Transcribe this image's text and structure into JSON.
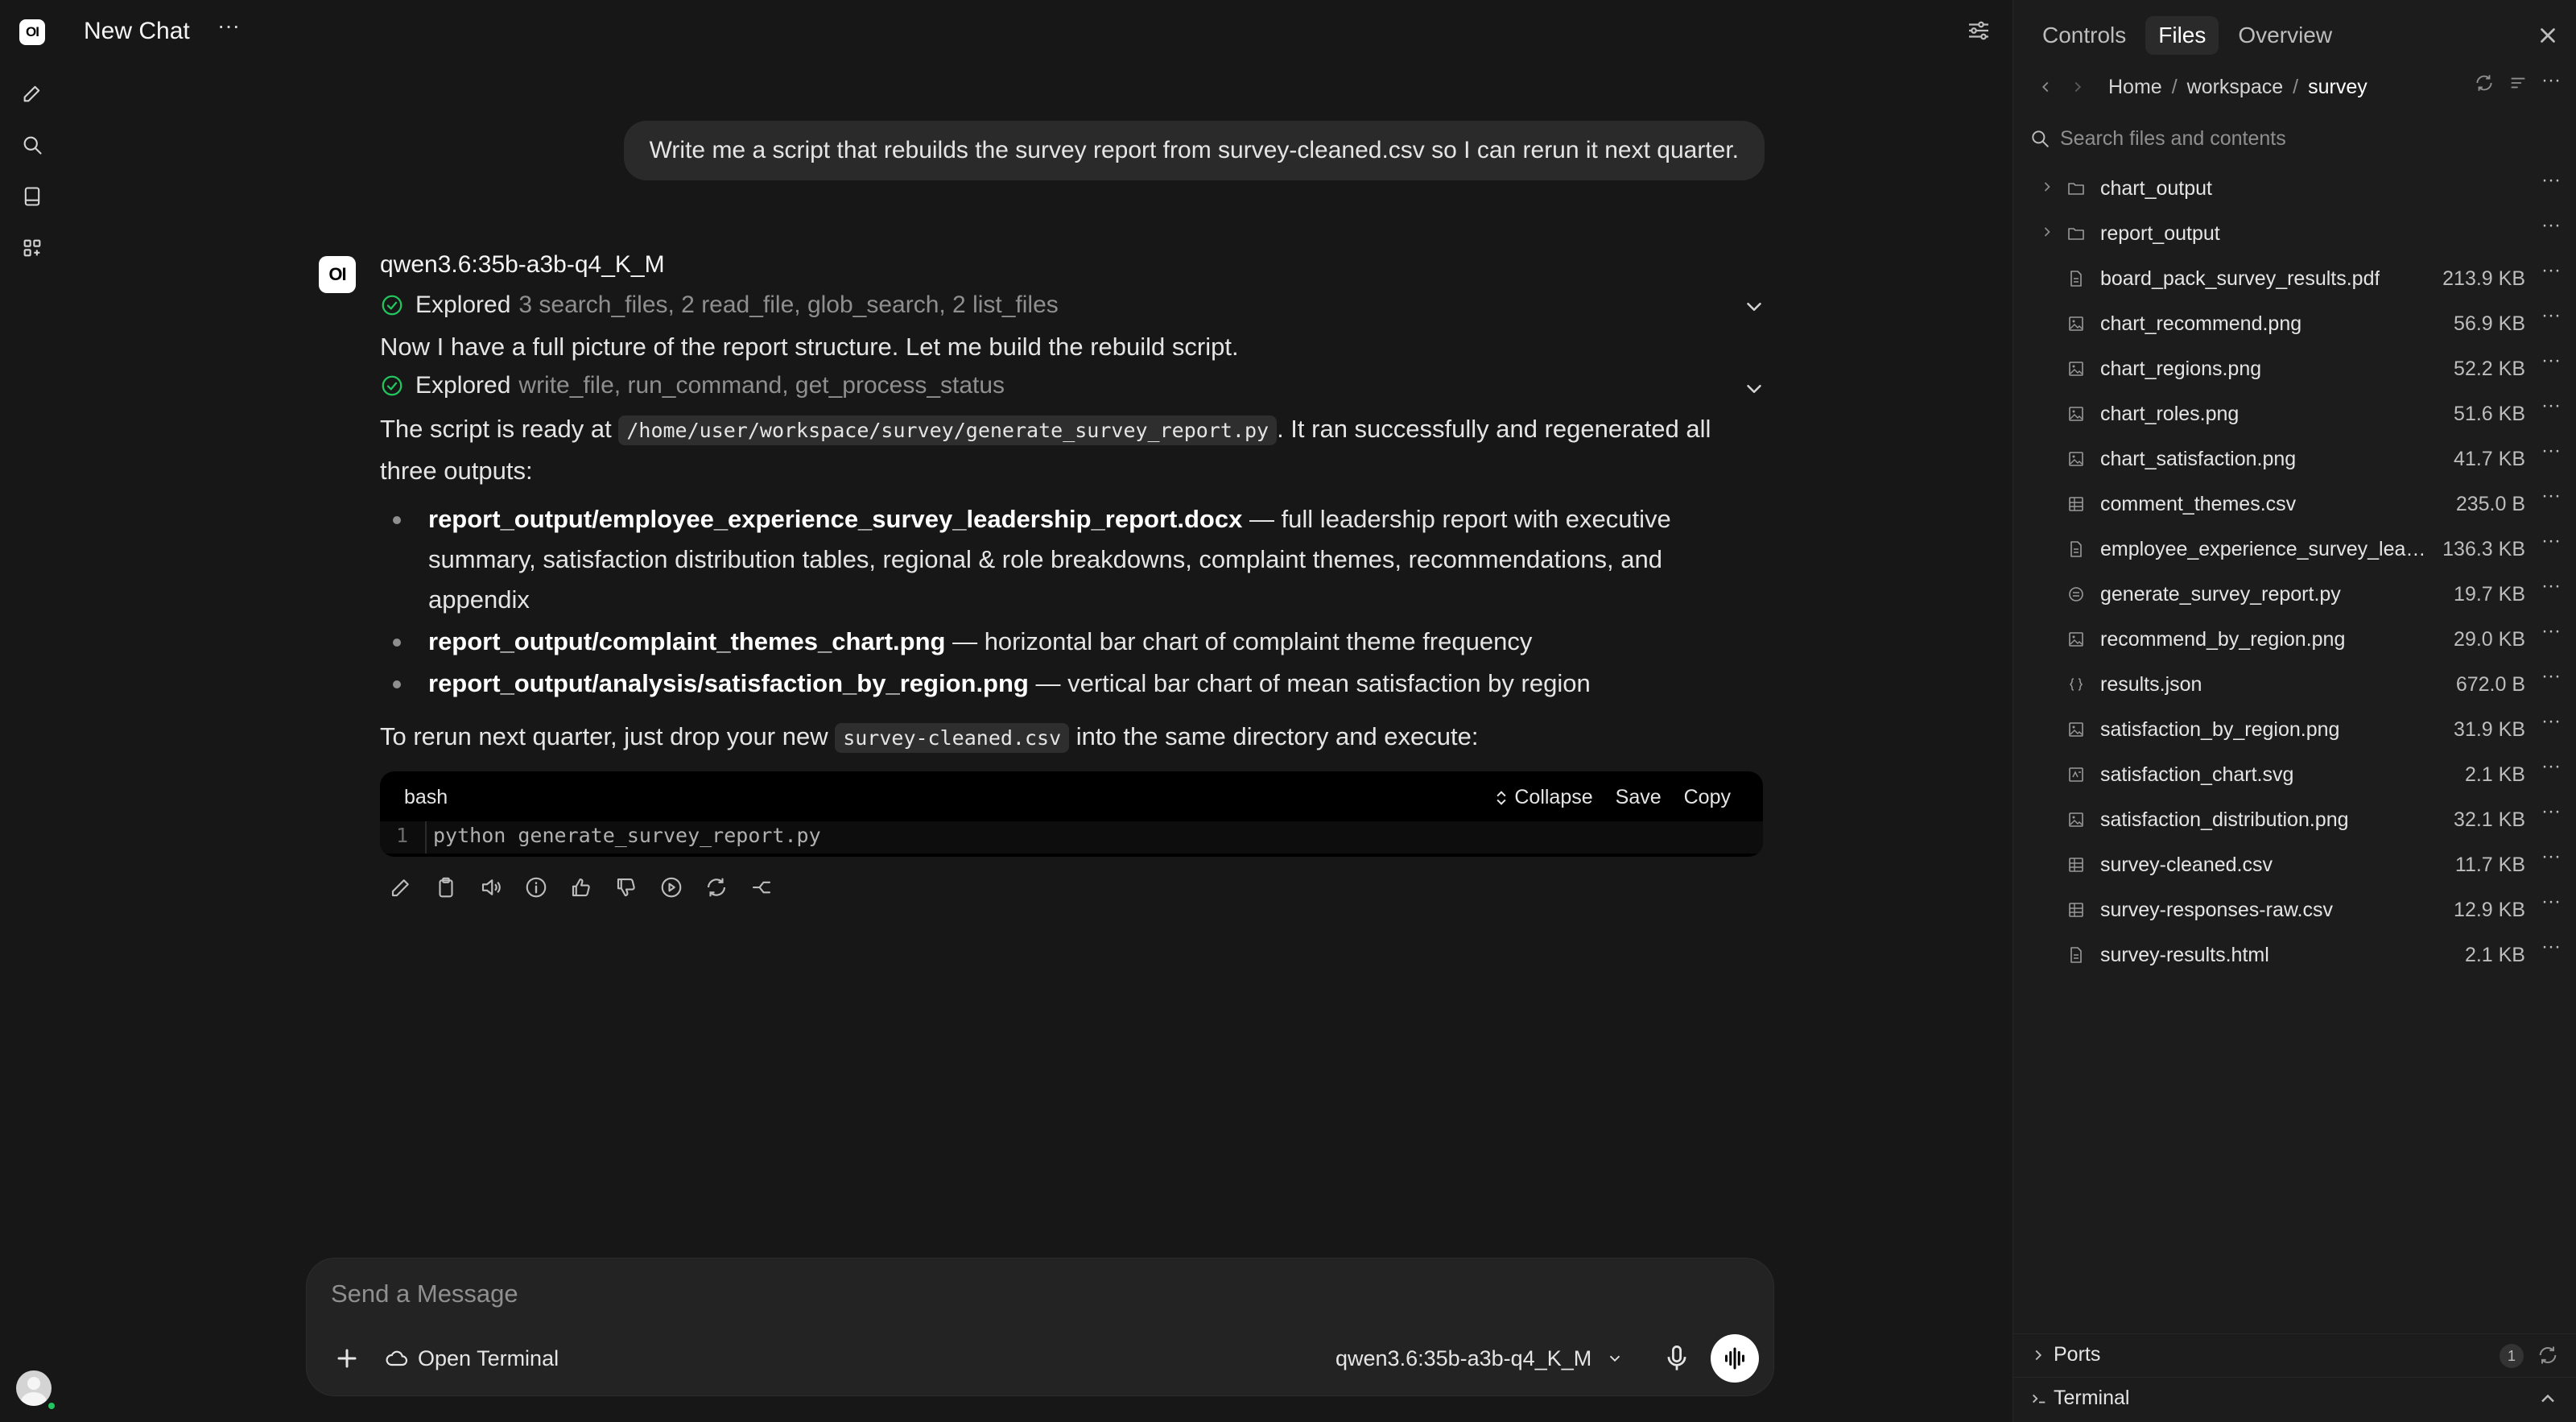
{
  "app": {
    "logo_text": "OI",
    "chat_title": "New Chat"
  },
  "conversation": {
    "user_message": "Write me a script that rebuilds the survey report from survey-cleaned.csv so I can rerun it next quarter.",
    "assistant_logo_text": "OI",
    "model_name": "qwen3.6:35b-a3b-q4_K_M",
    "explored_label": "Explored",
    "explored_1_tools": "3 search_files, 2 read_file, glob_search, 2 list_files",
    "paragraph_1": "Now I have a full picture of the report structure. Let me build the rebuild script.",
    "explored_2_tools": "write_file, run_command, get_process_status",
    "ready_prefix": "The script is ready at",
    "script_path": "/home/user/workspace/survey/generate_survey_report.py",
    "ready_suffix": ". It ran successfully and regenerated all three outputs:",
    "bullets": [
      {
        "bold": "report_output/employee_experience_survey_leadership_report.docx",
        "rest": " — full leadership report with executive summary, satisfaction distribution tables, regional & role breakdowns, complaint themes, recommendations, and appendix"
      },
      {
        "bold": "report_output/complaint_themes_chart.png",
        "rest": " — horizontal bar chart of complaint theme frequency"
      },
      {
        "bold": "report_output/analysis/satisfaction_by_region.png",
        "rest": " — vertical bar chart of mean satisfaction by region"
      }
    ],
    "rerun_prefix": "To rerun next quarter, just drop your new",
    "rerun_file": "survey-cleaned.csv",
    "rerun_suffix": "into the same directory and execute:",
    "code": {
      "lang": "bash",
      "collapse_label": "Collapse",
      "save_label": "Save",
      "copy_label": "Copy",
      "line_number": "1",
      "line": "python generate_survey_report.py"
    }
  },
  "composer": {
    "placeholder": "Send a Message",
    "terminal_label": "Open Terminal",
    "model": "qwen3.6:35b-a3b-q4_K_M"
  },
  "panel": {
    "tabs": [
      "Controls",
      "Files",
      "Overview"
    ],
    "active_tab": "Files",
    "breadcrumb": [
      "Home",
      "workspace",
      "survey"
    ],
    "search_placeholder": "Search files and contents",
    "files": [
      {
        "name": "chart_output",
        "size": "",
        "type": "folder"
      },
      {
        "name": "report_output",
        "size": "",
        "type": "folder"
      },
      {
        "name": "board_pack_survey_results.pdf",
        "size": "213.9 KB",
        "type": "doc"
      },
      {
        "name": "chart_recommend.png",
        "size": "56.9 KB",
        "type": "image"
      },
      {
        "name": "chart_regions.png",
        "size": "52.2 KB",
        "type": "image"
      },
      {
        "name": "chart_roles.png",
        "size": "51.6 KB",
        "type": "image"
      },
      {
        "name": "chart_satisfaction.png",
        "size": "41.7 KB",
        "type": "image"
      },
      {
        "name": "comment_themes.csv",
        "size": "235.0 B",
        "type": "table"
      },
      {
        "name": "employee_experience_survey_lead...",
        "size": "136.3 KB",
        "type": "doc"
      },
      {
        "name": "generate_survey_report.py",
        "size": "19.7 KB",
        "type": "code"
      },
      {
        "name": "recommend_by_region.png",
        "size": "29.0 KB",
        "type": "image"
      },
      {
        "name": "results.json",
        "size": "672.0 B",
        "type": "json"
      },
      {
        "name": "satisfaction_by_region.png",
        "size": "31.9 KB",
        "type": "image"
      },
      {
        "name": "satisfaction_chart.svg",
        "size": "2.1 KB",
        "type": "svg"
      },
      {
        "name": "satisfaction_distribution.png",
        "size": "32.1 KB",
        "type": "image"
      },
      {
        "name": "survey-cleaned.csv",
        "size": "11.7 KB",
        "type": "table"
      },
      {
        "name": "survey-responses-raw.csv",
        "size": "12.9 KB",
        "type": "table"
      },
      {
        "name": "survey-results.html",
        "size": "2.1 KB",
        "type": "doc"
      }
    ],
    "ports_label": "Ports",
    "ports_count": "1",
    "terminal_label": "Terminal"
  }
}
